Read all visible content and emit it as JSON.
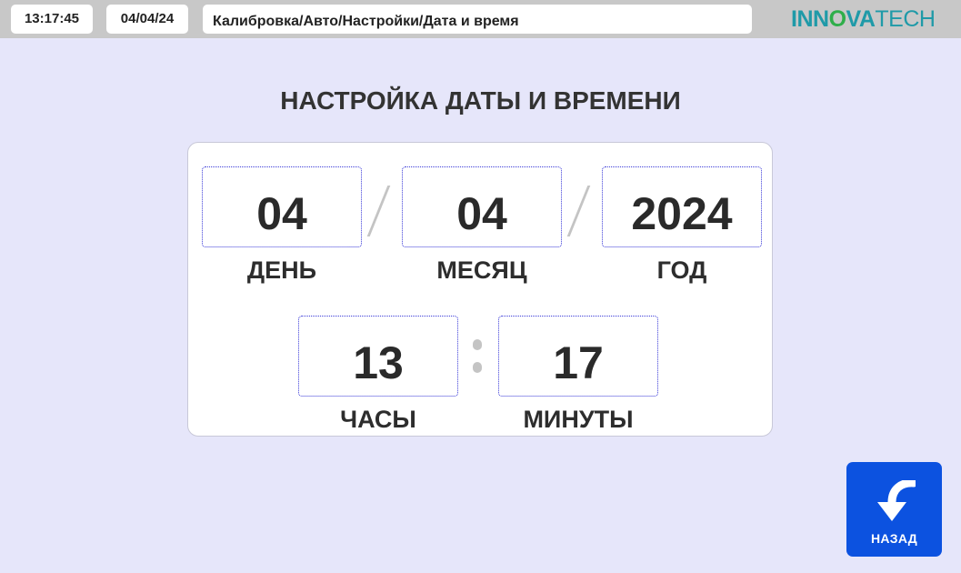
{
  "header": {
    "time": "13:17:45",
    "date": "04/04/24",
    "breadcrumb": "Калибровка/Авто/Настройки/Дата и время",
    "logo": {
      "part1": "IN",
      "part2": "N",
      "part3": "O",
      "part4": "VA",
      "part5": "TECH"
    }
  },
  "page": {
    "title": "НАСТРОЙКА ДАТЫ И ВРЕМЕНИ"
  },
  "date_fields": {
    "day": {
      "value": "04",
      "label": "ДЕНЬ"
    },
    "month": {
      "value": "04",
      "label": "МЕСЯЦ"
    },
    "year": {
      "value": "2024",
      "label": "ГОД"
    }
  },
  "time_fields": {
    "hours": {
      "value": "13",
      "label": "ЧАСЫ"
    },
    "minutes": {
      "value": "17",
      "label": "МИНУТЫ"
    }
  },
  "back_button": {
    "label": "НАЗАД",
    "icon": "curved-back-arrow-icon"
  },
  "colors": {
    "background": "#e6e6fa",
    "topbar": "#c8c8c8",
    "accent_button": "#0c52e0",
    "field_border": "#3a3ad8",
    "logo_teal": "#1f9aa8",
    "logo_green": "#2fae4a"
  }
}
